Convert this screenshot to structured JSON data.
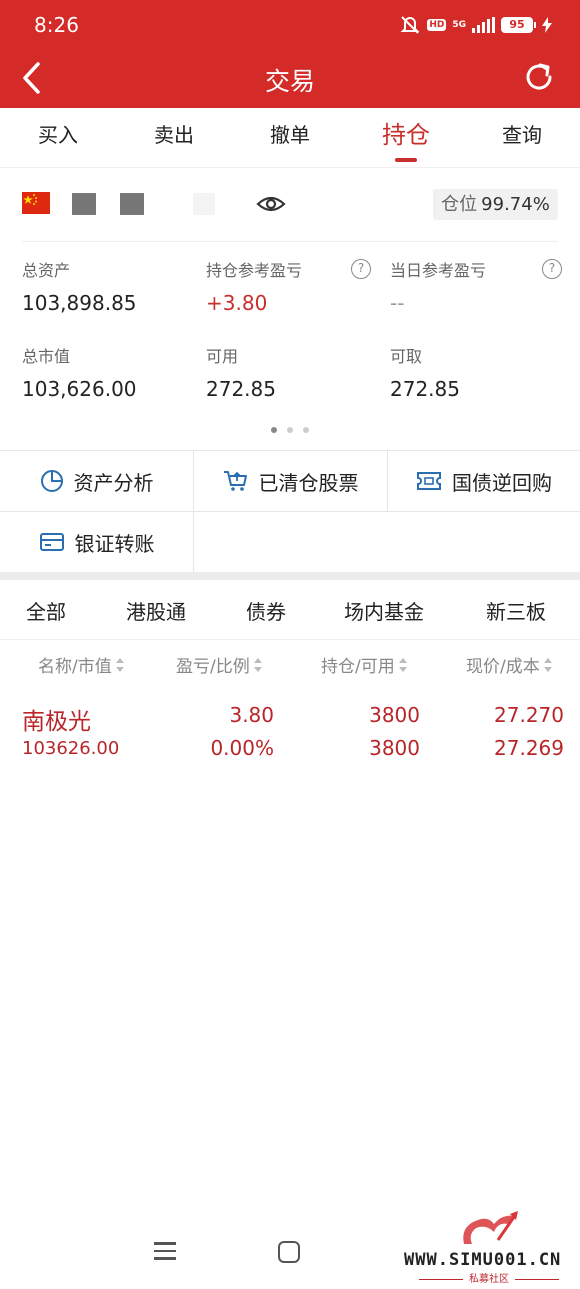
{
  "status_bar": {
    "time": "8:26",
    "network": "5G",
    "hd": "HD",
    "battery": "95"
  },
  "header": {
    "title": "交易"
  },
  "tabs": [
    {
      "label": "买入",
      "active": false
    },
    {
      "label": "卖出",
      "active": false
    },
    {
      "label": "撤单",
      "active": false
    },
    {
      "label": "持仓",
      "active": true
    },
    {
      "label": "查询",
      "active": false
    }
  ],
  "account": {
    "position_label": "仓位",
    "position_value": "99.74%",
    "total_assets_label": "总资产",
    "total_assets": "103,898.85",
    "holding_pnl_label": "持仓参考盈亏",
    "holding_pnl": "+3.80",
    "daily_pnl_label": "当日参考盈亏",
    "daily_pnl": "--",
    "market_value_label": "总市值",
    "market_value": "103,626.00",
    "available_label": "可用",
    "available": "272.85",
    "withdrawable_label": "可取",
    "withdrawable": "272.85",
    "help_symbol": "?"
  },
  "functions": [
    {
      "label": "资产分析",
      "icon": "pie-chart-icon"
    },
    {
      "label": "已清仓股票",
      "icon": "cart-icon"
    },
    {
      "label": "国债逆回购",
      "icon": "ticket-icon"
    },
    {
      "label": "银证转账",
      "icon": "card-icon"
    }
  ],
  "categories": [
    "全部",
    "港股通",
    "债券",
    "场内基金",
    "新三板"
  ],
  "table": {
    "headers": [
      "名称/市值",
      "盈亏/比例",
      "持仓/可用",
      "现价/成本"
    ],
    "rows": [
      {
        "name": "南极光",
        "market_value": "103626.00",
        "pnl": "3.80",
        "pnl_ratio": "0.00%",
        "holding": "3800",
        "available": "3800",
        "price": "27.270",
        "cost": "27.269"
      }
    ]
  },
  "watermark": {
    "site": "WWW.SIMU001.CN",
    "sub": "私募社区"
  },
  "colors": {
    "brand_red": "#d42a28",
    "profit_red": "#c7302c",
    "icon_blue": "#2a6fb0"
  }
}
